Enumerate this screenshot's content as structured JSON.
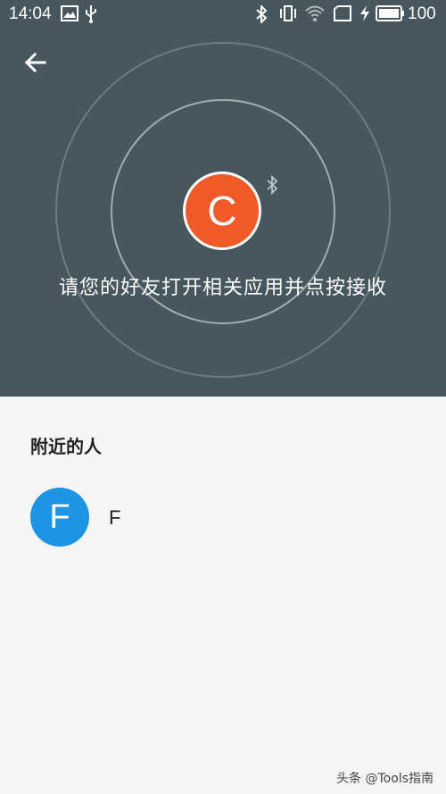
{
  "status_bar": {
    "time": "14:04",
    "battery": "100",
    "icons": [
      "image-icon",
      "usb-icon",
      "bluetooth-icon",
      "vibrate-icon",
      "wifi-icon",
      "sim-icon",
      "charging-icon",
      "battery-icon"
    ]
  },
  "share": {
    "sender_initial": "C",
    "hint": "请您的好友打开相关应用并点按接收",
    "accent": "#f05a28",
    "background": "#46575f"
  },
  "nearby": {
    "title": "附近的人",
    "people": [
      {
        "initial": "F",
        "name": "F",
        "color": "#1e95e2"
      }
    ]
  },
  "watermark": "头条 @Tools指南"
}
